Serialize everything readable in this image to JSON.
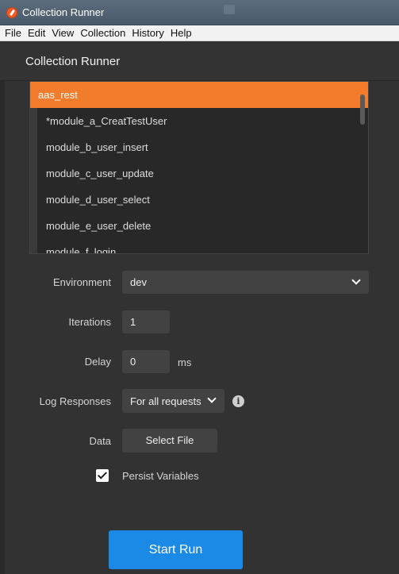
{
  "window": {
    "title": "Collection Runner"
  },
  "menu": [
    "File",
    "Edit",
    "View",
    "Collection",
    "History",
    "Help"
  ],
  "header": {
    "title": "Collection Runner"
  },
  "collections": {
    "selected": "aas_rest",
    "items": [
      "*module_a_CreatTestUser",
      "module_b_user_insert",
      "module_c_user_update",
      "module_d_user_select",
      "module_e_user_delete",
      "module_f_login"
    ]
  },
  "form": {
    "environment": {
      "label": "Environment",
      "value": "dev"
    },
    "iterations": {
      "label": "Iterations",
      "value": "1"
    },
    "delay": {
      "label": "Delay",
      "value": "0",
      "unit": "ms"
    },
    "log_responses": {
      "label": "Log Responses",
      "value": "For all requests"
    },
    "data": {
      "label": "Data",
      "button": "Select File"
    },
    "persist_variables": {
      "label": "Persist Variables",
      "checked": true
    }
  },
  "actions": {
    "start_run": "Start Run"
  },
  "colors": {
    "accent": "#f37c2c",
    "primary": "#1a8ae6"
  }
}
